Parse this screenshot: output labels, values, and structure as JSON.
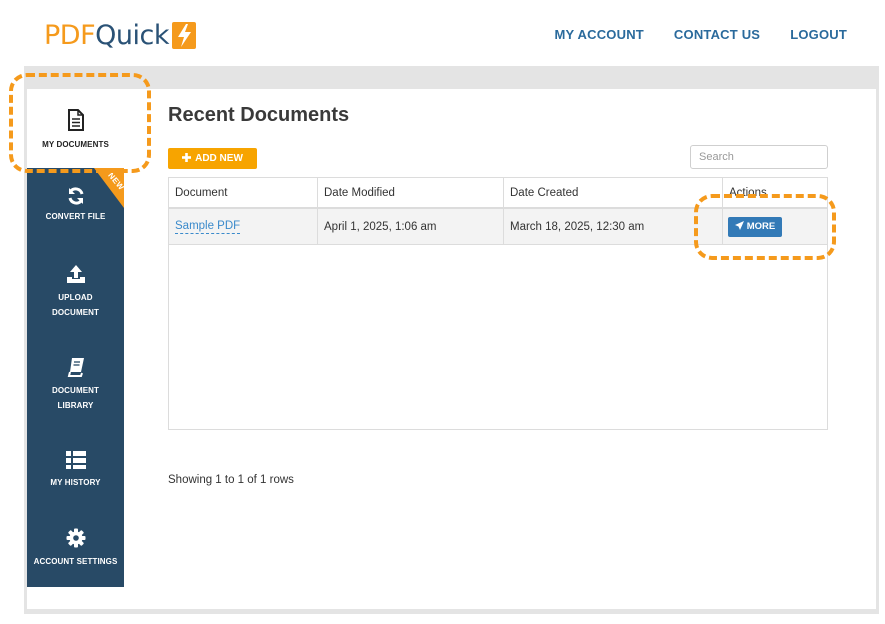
{
  "brand": {
    "logo_part1": "PDF",
    "logo_part2": "Quick"
  },
  "topnav": {
    "my_account": "MY ACCOUNT",
    "contact_us": "CONTACT US",
    "logout": "LOGOUT"
  },
  "sidebar": {
    "my_documents": "MY DOCUMENTS",
    "convert_file": "CONVERT FILE",
    "new_badge": "NEW",
    "upload_line1": "UPLOAD",
    "upload_line2": "DOCUMENT",
    "library_line1": "DOCUMENT",
    "library_line2": "LIBRARY",
    "my_history": "MY HISTORY",
    "account_settings": "ACCOUNT SETTINGS"
  },
  "main": {
    "title": "Recent Documents",
    "add_new_label": "ADD NEW",
    "search_placeholder": "Search",
    "columns": [
      "Document",
      "Date Modified",
      "Date Created",
      "Actions"
    ],
    "rows": [
      {
        "document": "Sample PDF",
        "date_modified": "April 1, 2025, 1:06 am",
        "date_created": "March 18, 2025, 12:30 am",
        "action_label": "MORE"
      }
    ],
    "pagination_text": "Showing 1 to 1 of 1 rows"
  },
  "colors": {
    "accent_orange": "#f59a1c",
    "sidebar_navy": "#284a66",
    "link_blue": "#2a6a9c",
    "button_blue": "#337ab7"
  }
}
